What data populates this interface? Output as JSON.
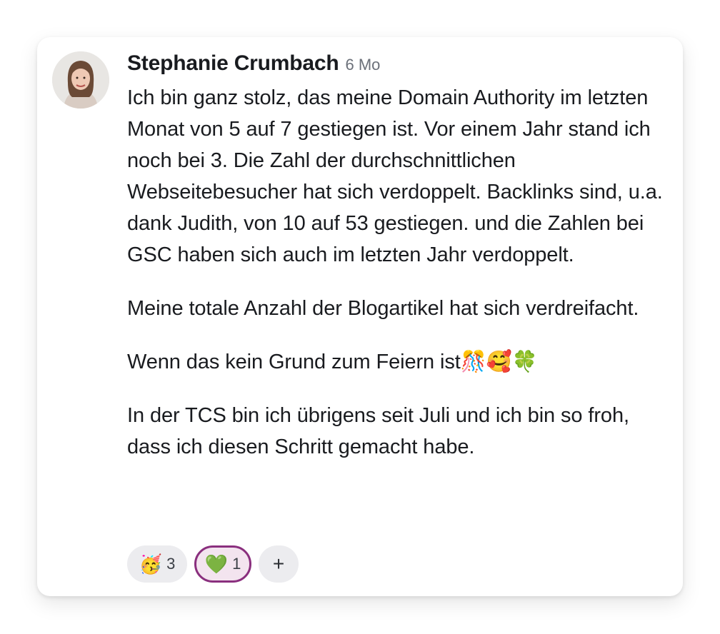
{
  "post": {
    "author": "Stephanie Crumbach",
    "time": "6 Mo",
    "paragraphs": [
      "Ich bin ganz stolz, das meine Domain Authority im letzten Monat von 5 auf 7 gestiegen ist. Vor einem Jahr stand ich noch bei 3. Die Zahl der durchschnittlichen Webseitebesucher hat sich verdoppelt. Backlinks sind, u.a. dank Judith, von 10 auf 53 gestiegen. und die Zahlen bei GSC haben sich auch im letzten Jahr verdoppelt.",
      "Meine totale Anzahl der Blogartikel hat sich verdreifacht.",
      "Wenn das kein Grund zum Feiern ist🎊🥰🍀",
      "In der TCS bin ich übrigens seit Juli und ich bin so froh, dass ich diesen Schritt gemacht habe."
    ]
  },
  "reactions": [
    {
      "emoji": "🥳",
      "count": "3"
    },
    {
      "emoji": "💚",
      "count": "1"
    }
  ],
  "add_reaction_label": "+",
  "colors": {
    "active_reaction_border": "#8a2f7e",
    "active_reaction_bg": "#f3e4ef",
    "reaction_bg": "#ececef"
  }
}
